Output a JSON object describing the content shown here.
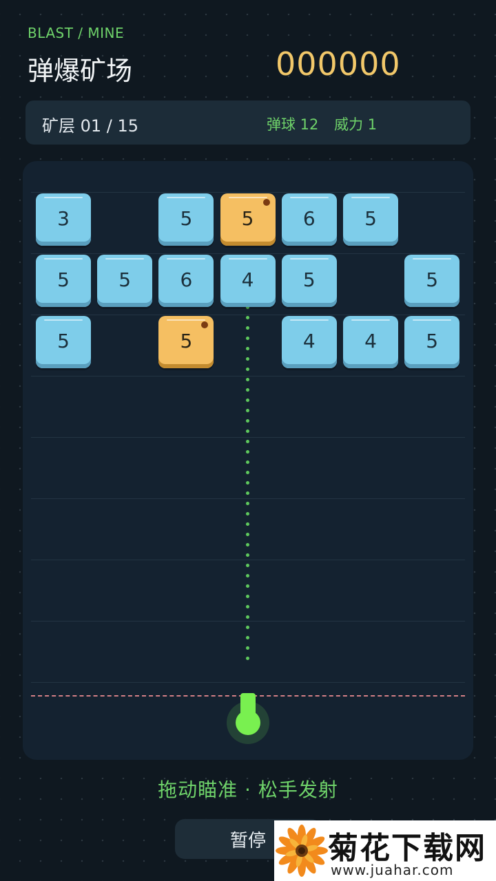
{
  "header": {
    "subtitle": "BLAST / MINE",
    "title": "弹爆矿场",
    "score": "000000"
  },
  "status": {
    "level": "矿层 01 / 15",
    "balls": "弹球 12",
    "power": "威力 1"
  },
  "board": {
    "rows": [
      [
        {
          "value": "3",
          "type": "normal"
        },
        null,
        {
          "value": "5",
          "type": "normal"
        },
        {
          "value": "5",
          "type": "gold"
        },
        {
          "value": "6",
          "type": "normal"
        },
        {
          "value": "5",
          "type": "normal"
        },
        null
      ],
      [
        {
          "value": "5",
          "type": "normal"
        },
        {
          "value": "5",
          "type": "normal"
        },
        {
          "value": "6",
          "type": "normal"
        },
        {
          "value": "4",
          "type": "normal"
        },
        {
          "value": "5",
          "type": "normal"
        },
        null,
        {
          "value": "5",
          "type": "normal"
        }
      ],
      [
        {
          "value": "5",
          "type": "normal"
        },
        null,
        {
          "value": "5",
          "type": "gold"
        },
        null,
        {
          "value": "4",
          "type": "normal"
        },
        {
          "value": "4",
          "type": "normal"
        },
        {
          "value": "5",
          "type": "normal"
        }
      ]
    ]
  },
  "hint": "拖动瞄准 · 松手发射",
  "controls": {
    "pause_label": "暂停"
  },
  "watermark": {
    "title": "菊花下载网",
    "url": "www.juahar.com"
  },
  "colors": {
    "accent": "#6fd36a",
    "score": "#f2c86a",
    "block_normal": "#7ecdea",
    "block_gold": "#f5bf62",
    "launcher": "#79f050",
    "deadline": "#d47f86"
  }
}
